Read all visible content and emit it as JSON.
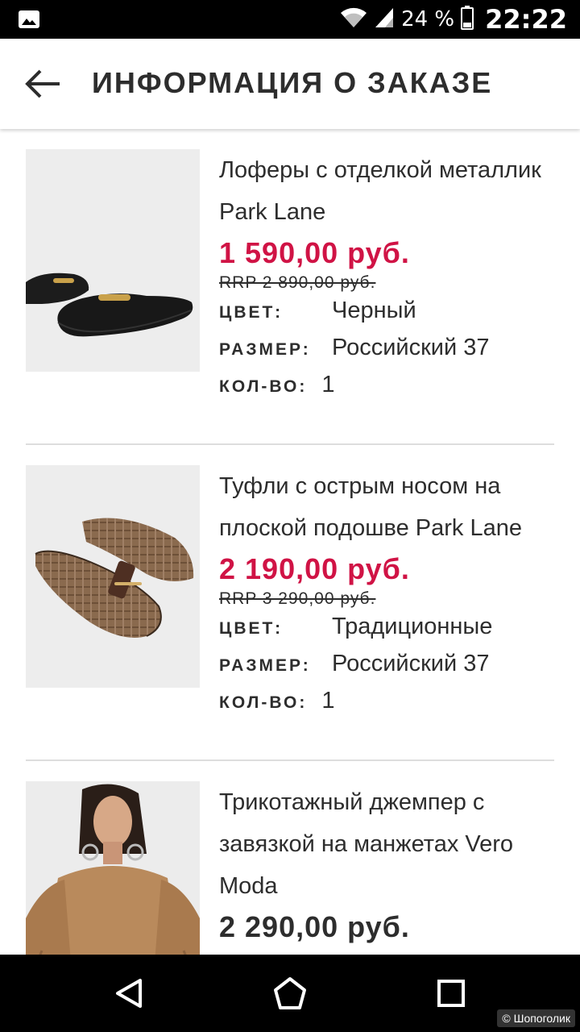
{
  "status_bar": {
    "battery_pct": "24 %",
    "time": "22:22",
    "icons": [
      "image-icon",
      "wifi-icon",
      "signal-icon",
      "battery-icon"
    ]
  },
  "header": {
    "title": "ИНФОРМАЦИЯ О ЗАКАЗЕ",
    "back_icon": "back-arrow-icon"
  },
  "items": [
    {
      "title": "Лоферы с отделкой металлик Park Lane",
      "price": "1 590,00 руб.",
      "rrp": "RRP 2 890,00 руб.",
      "color_label": "ЦВЕТ:",
      "color": "Черный",
      "size_label": "РАЗМЕР:",
      "size": "Российский 37",
      "qty_label": "КОЛ-ВО:",
      "qty": "1"
    },
    {
      "title": "Туфли с острым носом на плоской подошве Park Lane",
      "price": "2 190,00 руб.",
      "rrp": "RRP 3 290,00 руб.",
      "color_label": "ЦВЕТ:",
      "color": "Традиционные",
      "size_label": "РАЗМЕР:",
      "size": "Российский 37",
      "qty_label": "КОЛ-ВО:",
      "qty": "1"
    },
    {
      "title": "Трикотажный джемпер с завязкой на манжетах Vero Moda",
      "price": "2 290,00 руб."
    }
  ],
  "nav": {
    "icons": [
      "back-triangle-icon",
      "home-icon",
      "recents-icon"
    ]
  },
  "watermark": "© Шопоголик",
  "colors": {
    "sale_price": "#d01345",
    "text": "#2d2d2d",
    "divider": "#dddddd"
  }
}
